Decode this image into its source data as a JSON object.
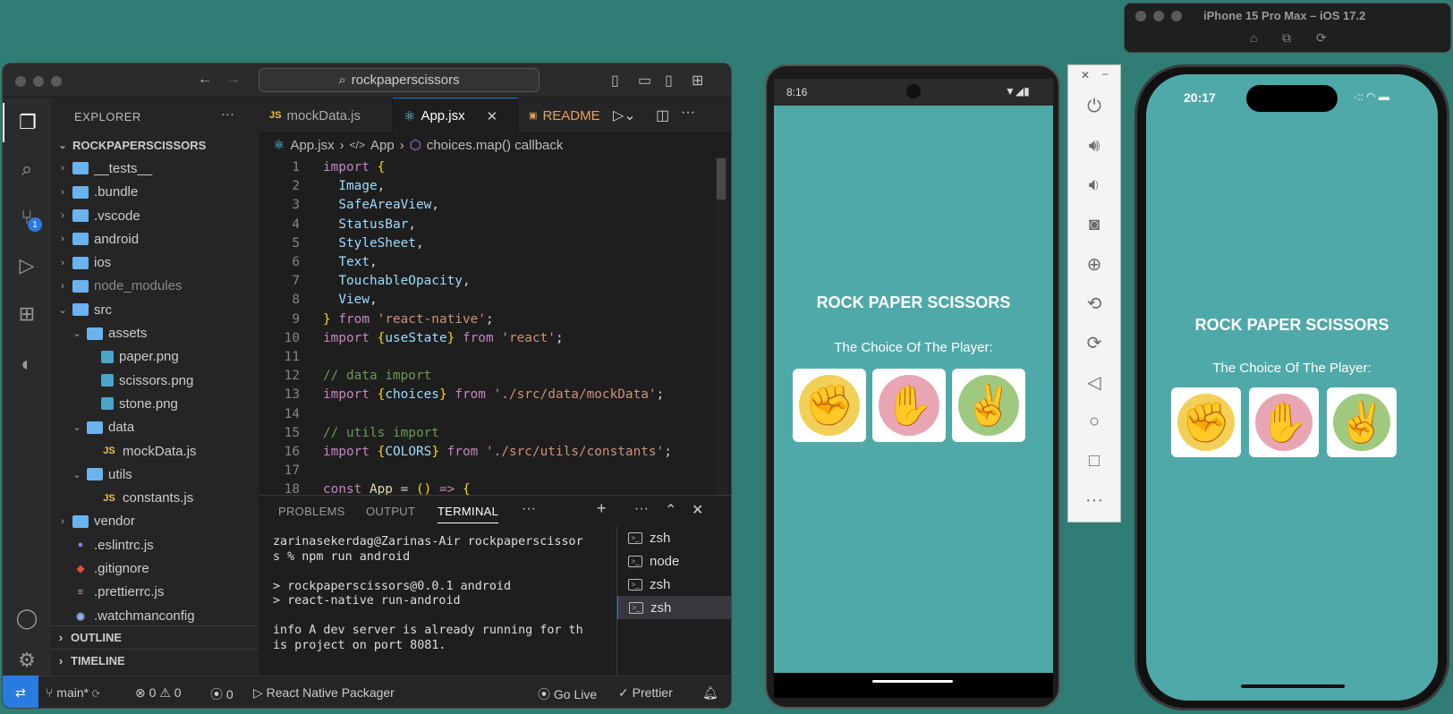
{
  "vscode": {
    "search": "rockpaperscissors",
    "explorer_title": "EXPLORER",
    "project": "ROCKPAPERSCISSORS",
    "scm_badge": "1",
    "tree": [
      {
        "label": "__tests__",
        "type": "folder",
        "depth": 1,
        "open": false
      },
      {
        "label": ".bundle",
        "type": "folder",
        "depth": 1,
        "open": false
      },
      {
        "label": ".vscode",
        "type": "folder",
        "depth": 1,
        "open": false
      },
      {
        "label": "android",
        "type": "folder",
        "depth": 1,
        "open": false
      },
      {
        "label": "ios",
        "type": "folder",
        "depth": 1,
        "open": false
      },
      {
        "label": "node_modules",
        "type": "folder",
        "depth": 1,
        "open": false,
        "muted": true
      },
      {
        "label": "src",
        "type": "folder",
        "depth": 1,
        "open": true
      },
      {
        "label": "assets",
        "type": "folder",
        "depth": 2,
        "open": true
      },
      {
        "label": "paper.png",
        "type": "image",
        "depth": 3
      },
      {
        "label": "scissors.png",
        "type": "image",
        "depth": 3
      },
      {
        "label": "stone.png",
        "type": "image",
        "depth": 3
      },
      {
        "label": "data",
        "type": "folder",
        "depth": 2,
        "open": true
      },
      {
        "label": "mockData.js",
        "type": "js",
        "depth": 3
      },
      {
        "label": "utils",
        "type": "folder",
        "depth": 2,
        "open": true
      },
      {
        "label": "constants.js",
        "type": "js",
        "depth": 3
      },
      {
        "label": "vendor",
        "type": "folder",
        "depth": 1,
        "open": false
      },
      {
        "label": ".eslintrc.js",
        "type": "eslint",
        "depth": 1
      },
      {
        "label": ".gitignore",
        "type": "git",
        "depth": 1
      },
      {
        "label": ".prettierrc.js",
        "type": "prettier",
        "depth": 1
      },
      {
        "label": ".watchmanconfig",
        "type": "watchman",
        "depth": 1
      }
    ],
    "outline": "OUTLINE",
    "timeline": "TIMELINE",
    "tabs": [
      "mockData.js",
      "App.jsx",
      "README"
    ],
    "breadcrumb": [
      "App.jsx",
      "App",
      "choices.map() callback"
    ],
    "code_lines": [
      [
        [
          "k",
          "import "
        ],
        [
          "b",
          "{"
        ]
      ],
      [
        [
          "v",
          "  Image"
        ],
        [
          "t",
          ","
        ]
      ],
      [
        [
          "v",
          "  SafeAreaView"
        ],
        [
          "t",
          ","
        ]
      ],
      [
        [
          "v",
          "  StatusBar"
        ],
        [
          "t",
          ","
        ]
      ],
      [
        [
          "v",
          "  StyleSheet"
        ],
        [
          "t",
          ","
        ]
      ],
      [
        [
          "v",
          "  Text"
        ],
        [
          "t",
          ","
        ]
      ],
      [
        [
          "v",
          "  TouchableOpacity"
        ],
        [
          "t",
          ","
        ]
      ],
      [
        [
          "v",
          "  View"
        ],
        [
          "t",
          ","
        ]
      ],
      [
        [
          "b",
          "}"
        ],
        [
          "k",
          " from "
        ],
        [
          "s",
          "'react-native'"
        ],
        [
          "t",
          ";"
        ]
      ],
      [
        [
          "k",
          "import "
        ],
        [
          "b",
          "{"
        ],
        [
          "v",
          "useState"
        ],
        [
          "b",
          "}"
        ],
        [
          "k",
          " from "
        ],
        [
          "s",
          "'react'"
        ],
        [
          "t",
          ";"
        ]
      ],
      [],
      [
        [
          "c",
          "// data import"
        ]
      ],
      [
        [
          "k",
          "import "
        ],
        [
          "b",
          "{"
        ],
        [
          "v",
          "choices"
        ],
        [
          "b",
          "}"
        ],
        [
          "k",
          " from "
        ],
        [
          "s",
          "'./src/data/mockData'"
        ],
        [
          "t",
          ";"
        ]
      ],
      [],
      [
        [
          "c",
          "// utils import"
        ]
      ],
      [
        [
          "k",
          "import "
        ],
        [
          "b",
          "{"
        ],
        [
          "v",
          "COLORS"
        ],
        [
          "b",
          "}"
        ],
        [
          "k",
          " from "
        ],
        [
          "s",
          "'./src/utils/constants'"
        ],
        [
          "t",
          ";"
        ]
      ],
      [],
      [
        [
          "k",
          "const "
        ],
        [
          "f",
          "App"
        ],
        [
          "t",
          " = "
        ],
        [
          "b",
          "()"
        ],
        [
          "k",
          " => "
        ],
        [
          "b",
          "{"
        ]
      ]
    ],
    "panel_tabs": [
      "PROBLEMS",
      "OUTPUT",
      "TERMINAL"
    ],
    "terminal_text": "zarinasekerdag@Zarinas-Air rockpaperscissor\ns % npm run android\n\n> rockpaperscissors@0.0.1 android\n> react-native run-android\n\ninfo A dev server is already running for th\nis project on port 8081.",
    "terminals": [
      "zsh",
      "node",
      "zsh",
      "zsh"
    ],
    "status": {
      "branch": "main*",
      "errors": "0",
      "warnings": "0",
      "ports": "0",
      "packager": "React Native Packager",
      "golive": "Go Live",
      "prettier": "Prettier"
    }
  },
  "android": {
    "time": "8:16"
  },
  "ios": {
    "window_title": "iPhone 15 Pro Max – iOS 17.2",
    "time": "20:17"
  },
  "app": {
    "title": "ROCK PAPER SCISSORS",
    "subtitle": "The Choice Of The Player:"
  },
  "choices": [
    {
      "name": "rock-icon",
      "glyph": "✊",
      "color": "#f2cf57"
    },
    {
      "name": "paper-icon",
      "glyph": "✋",
      "color": "#e8a5b3"
    },
    {
      "name": "scissors-icon",
      "glyph": "✌",
      "color": "#9ec97f"
    }
  ]
}
